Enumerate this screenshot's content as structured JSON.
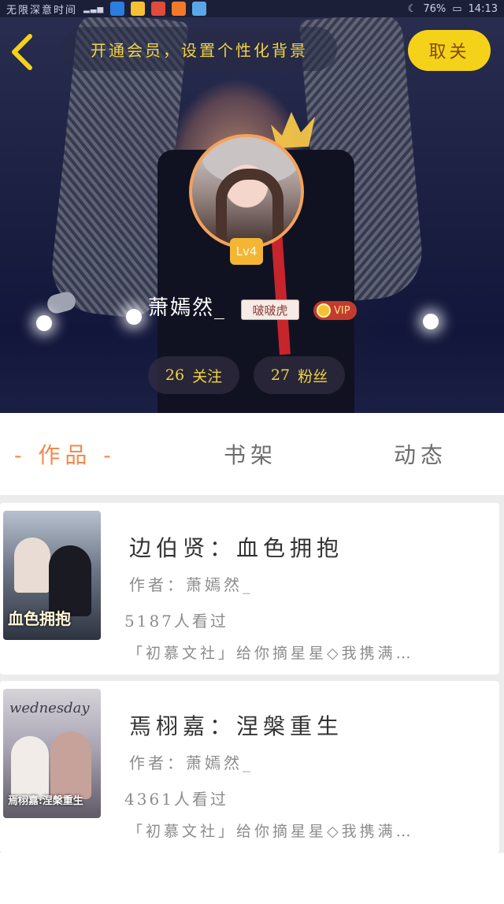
{
  "status_bar": {
    "carrier": "无限深意时间",
    "battery_percent": "76%",
    "time": "14:13"
  },
  "header": {
    "promo_text": "开通会员，设置个性化背景",
    "follow_label": "取关"
  },
  "profile": {
    "level": "Lv4",
    "username": "萧嫣然_",
    "name_tag": "啵啵虎",
    "vip_label": "VIP",
    "following_count": "26",
    "following_label": "关注",
    "fans_count": "27",
    "fans_label": "粉丝"
  },
  "tabs": [
    {
      "label": "- 作品 -",
      "active": true
    },
    {
      "label": "书架",
      "active": false
    },
    {
      "label": "动态",
      "active": false
    }
  ],
  "works": [
    {
      "title": "边伯贤：血色拥抱",
      "author": "作者：萧嫣然_",
      "views": "5187人看过",
      "description": "「初慕文社」给你摘星星◇我携满…",
      "cover_title": "血色拥抱",
      "cover_script": ""
    },
    {
      "title": "焉栩嘉：涅槃重生",
      "author": "作者：萧嫣然_",
      "views": "4361人看过",
      "description": "「初慕文社」给你摘星星◇我携满…",
      "cover_title": "焉栩嘉:涅槃重生",
      "cover_script": "wednesday"
    }
  ],
  "colors": {
    "accent_yellow": "#f5d21a",
    "tab_active": "#f08a4b",
    "vip_red": "#c23b2f"
  }
}
